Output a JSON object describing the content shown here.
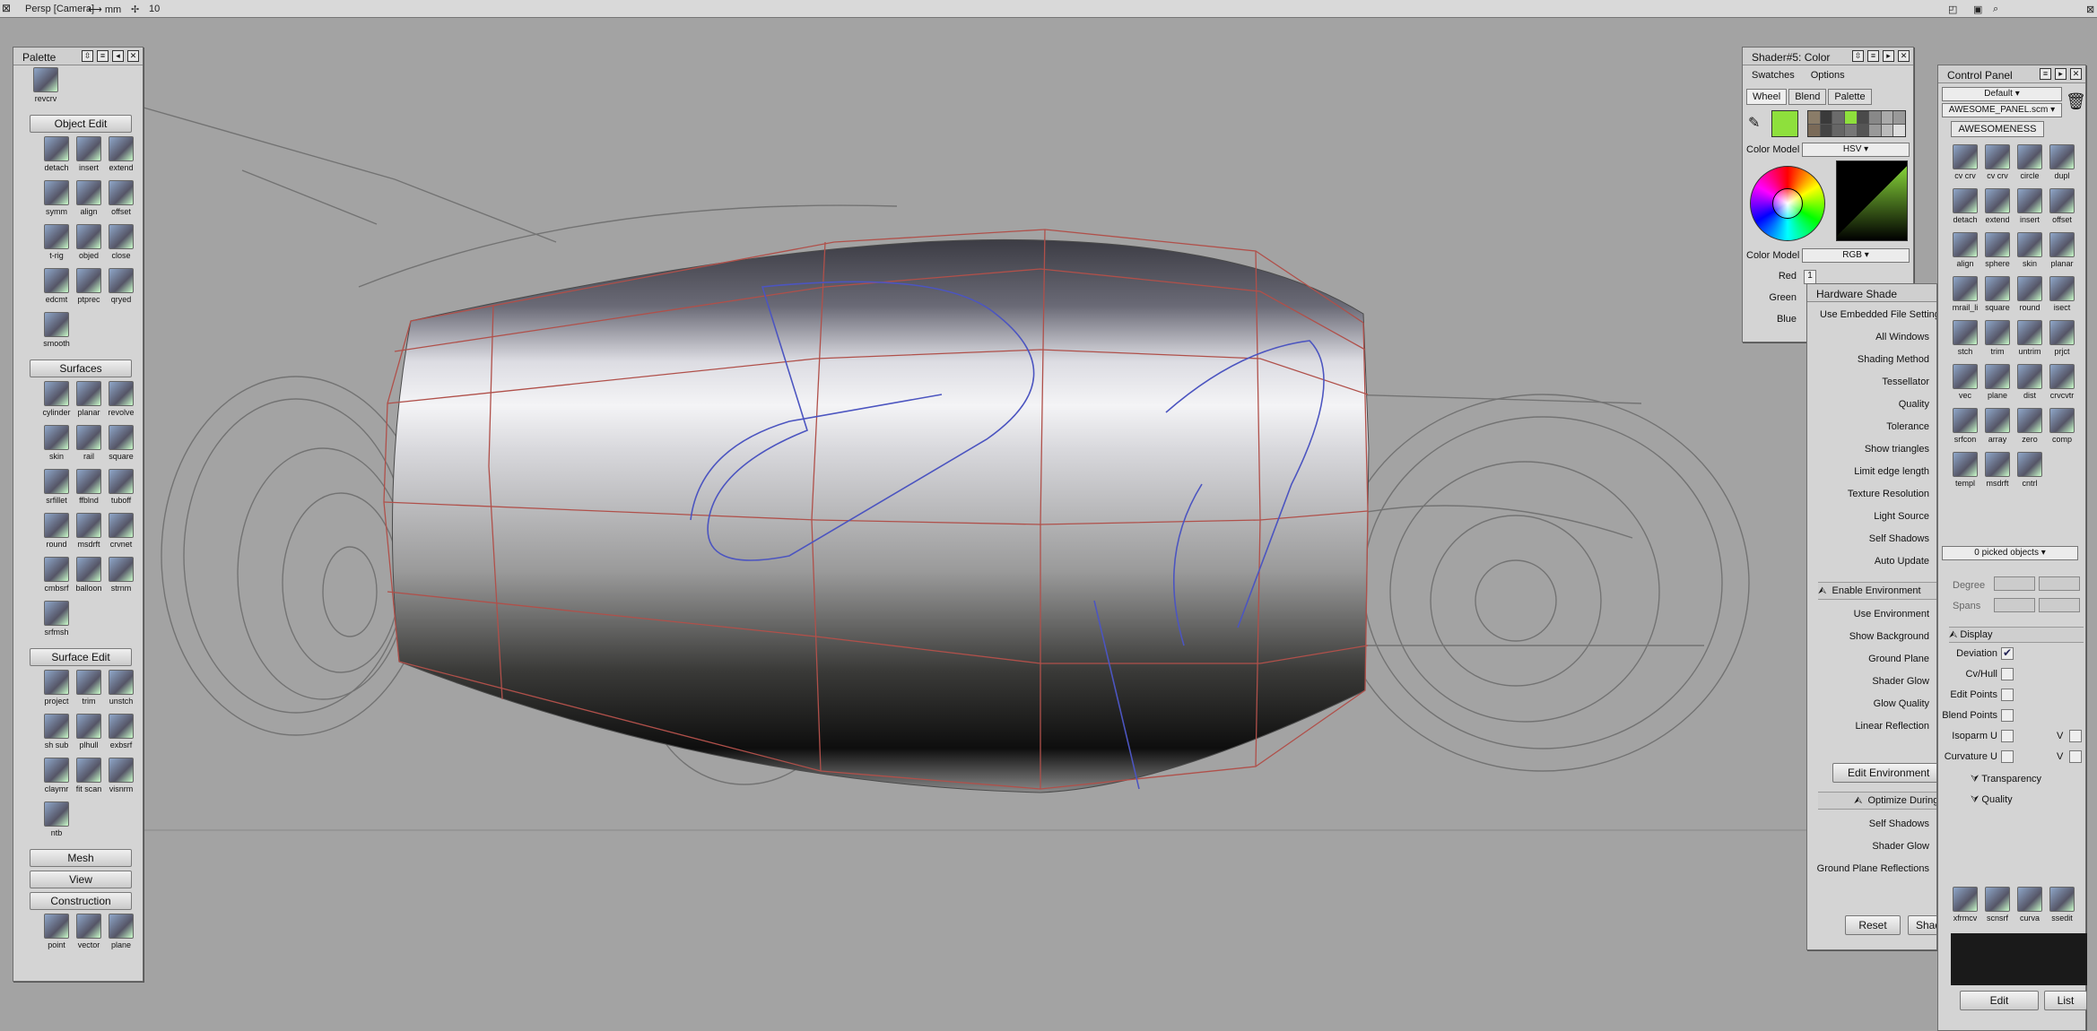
{
  "topbar": {
    "view_label": "Persp [Camera]",
    "units": "⟷ mm",
    "grid": "10"
  },
  "palette": {
    "title": "Palette",
    "first_tool": "revcrv",
    "sections": [
      {
        "name": "Object Edit",
        "tools": [
          "detach",
          "insert",
          "extend",
          "symm",
          "align",
          "offset",
          "t-rig",
          "objed",
          "close",
          "edcmt",
          "ptprec",
          "qryed",
          "smooth"
        ]
      },
      {
        "name": "Surfaces",
        "tools": [
          "cylinder",
          "planar",
          "revolve",
          "skin",
          "rail",
          "square",
          "srfillet",
          "ffblnd",
          "tuboff",
          "round",
          "msdrft",
          "crvnet",
          "cmbsrf",
          "balloon",
          "strnm",
          "srfmsh"
        ]
      },
      {
        "name": "Surface Edit",
        "tools": [
          "project",
          "trim",
          "unstch",
          "sh sub",
          "plhull",
          "exbsrf",
          "claymr",
          "fit scan",
          "visnrm",
          "ntb"
        ]
      }
    ],
    "collapsed": [
      "Mesh",
      "View"
    ],
    "construction": {
      "name": "Construction",
      "tools": [
        "point",
        "vector",
        "plane"
      ]
    }
  },
  "shader": {
    "title": "Shader#5: Color",
    "menu": [
      "Swatches",
      "Options"
    ],
    "tabs": [
      "Wheel",
      "Blend",
      "Palette"
    ],
    "current_color": "#8ee03c",
    "color_model_label": "Color Model",
    "color_model_1": "HSV",
    "color_model_2": "RGB",
    "channels": [
      "Red",
      "Green",
      "Blue"
    ],
    "red_value": "1"
  },
  "hardware_shade": {
    "title": "Hardware Shade",
    "options": [
      "Use Embedded File Settings",
      "All Windows",
      "Shading Method",
      "Tessellator",
      "Quality",
      "Tolerance",
      "Show triangles",
      "Limit edge length",
      "Texture Resolution",
      "Light Source",
      "Self Shadows",
      "Auto Update"
    ],
    "env_header": "Enable Environment",
    "env_options": [
      "Use Environment",
      "Show Background",
      "Ground Plane",
      "Shader Glow",
      "Glow Quality",
      "Linear Reflection"
    ],
    "edit_env": "Edit Environment",
    "opt_header": "Optimize During",
    "opt_options": [
      "Self Shadows",
      "Shader Glow",
      "Ground Plane Reflections"
    ],
    "reset": "Reset",
    "shade": "Shade"
  },
  "control_panel": {
    "title": "Control Panel",
    "preset": "Default",
    "shelf_file": "AWESOME_PANEL.scm",
    "shelf_tab": "AWESOMENESS",
    "tools": [
      "cv crv",
      "cv crv",
      "circle",
      "dupl",
      "detach",
      "extend",
      "insert",
      "offset",
      "align",
      "sphere",
      "skin",
      "planar",
      "mrail_li",
      "square",
      "round",
      "isect",
      "stch",
      "trim",
      "untrim",
      "prjct",
      "vec",
      "plane",
      "dist",
      "crvcvtr",
      "srfcon",
      "array",
      "zero",
      "comp",
      "templ",
      "msdrft",
      "cntrl"
    ],
    "picked": "0 picked objects",
    "degree": "Degree",
    "spans": "Spans",
    "display_header": "Display",
    "display_items": [
      {
        "label": "Deviation",
        "checked": true
      },
      {
        "label": "Cv/Hull",
        "checked": false
      },
      {
        "label": "Edit Points",
        "checked": false
      },
      {
        "label": "Blend Points",
        "checked": false
      },
      {
        "label": "Isoparm U",
        "checked": false,
        "v": "V"
      },
      {
        "label": "Curvature U",
        "checked": false,
        "v": "V"
      }
    ],
    "transparency": "Transparency",
    "quality": "Quality",
    "bottom_tools": [
      "xfrmcv",
      "scnsrf",
      "curva",
      "ssedit"
    ],
    "edit": "Edit",
    "list": "List"
  }
}
